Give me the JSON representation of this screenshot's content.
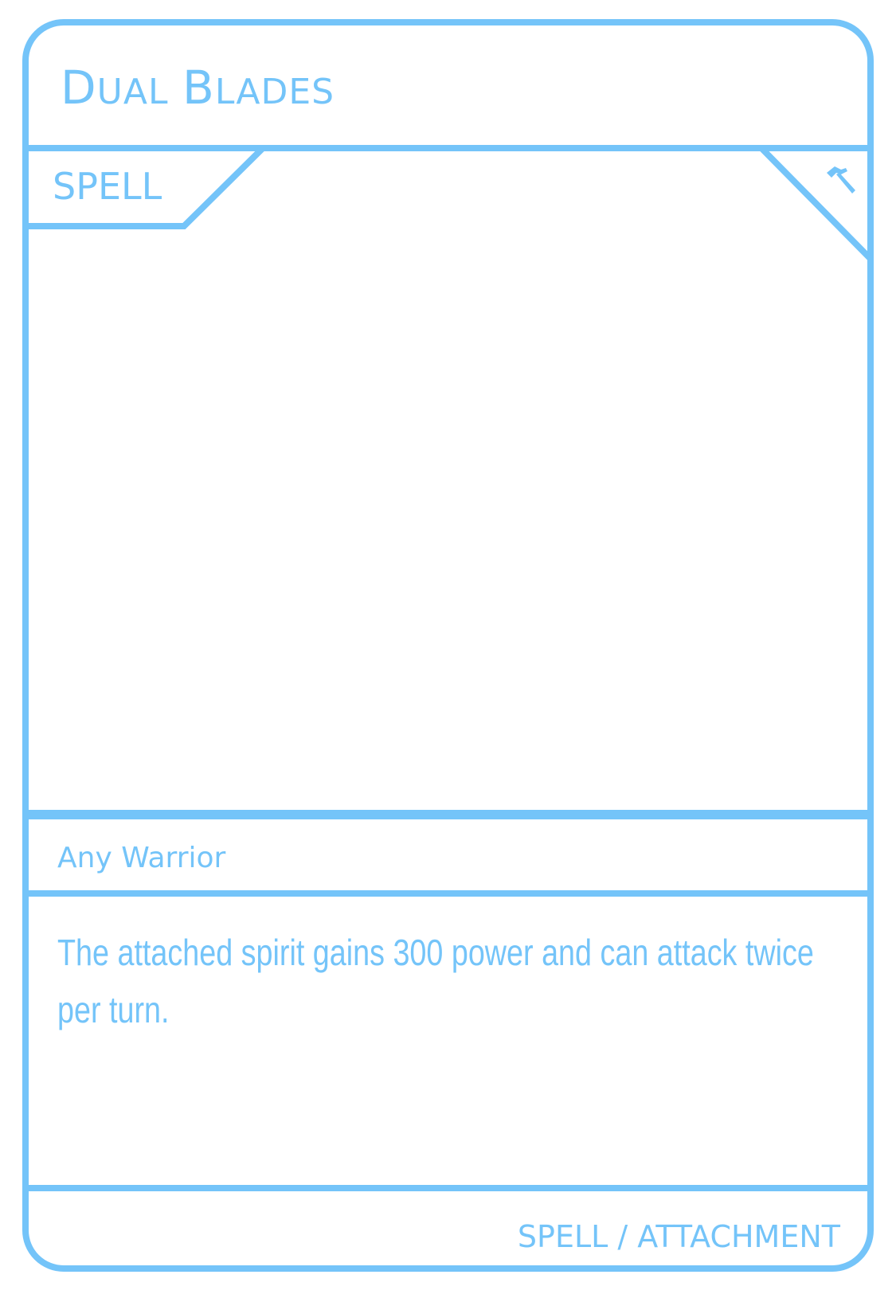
{
  "card": {
    "title_parts": [
      {
        "cap": "D",
        "rest": "UAL"
      },
      {
        "cap": "B",
        "rest": "LADES"
      }
    ],
    "type_tab": "SPELL",
    "corner_icon": "hammer-icon",
    "target": "Any Warrior",
    "effect_text": "The attached spirit gains 300 power and can attack twice per turn.",
    "footer_type": "SPELL / ATTACHMENT"
  },
  "colors": {
    "accent": "#74c4f9",
    "background": "#ffffff"
  }
}
